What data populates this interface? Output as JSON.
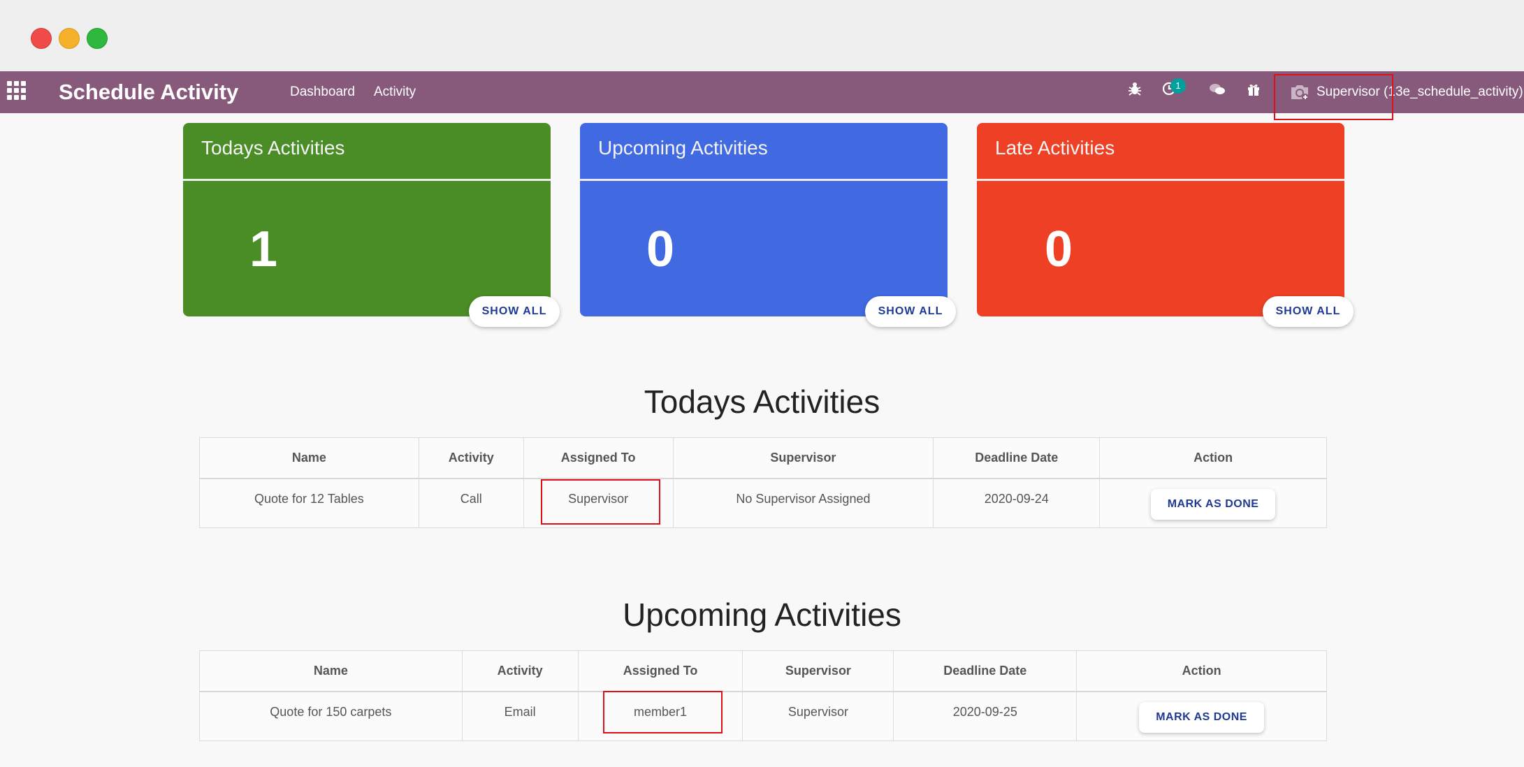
{
  "navbar": {
    "brand": "Schedule Activity",
    "menu": [
      "Dashboard",
      "Activity"
    ],
    "activity_badge": "1",
    "user": "Supervisor (13e_schedule_activity)",
    "colors": {
      "bar": "#875a7b"
    }
  },
  "cards": [
    {
      "title": "Todays Activities",
      "count": "1",
      "button": "SHOW ALL",
      "color": "#4a8d26"
    },
    {
      "title": "Upcoming Activities",
      "count": "0",
      "button": "SHOW ALL",
      "color": "#4169e1"
    },
    {
      "title": "Late Activities",
      "count": "0",
      "button": "SHOW ALL",
      "color": "#ee4024"
    }
  ],
  "today": {
    "title": "Todays Activities",
    "headers": [
      "Name",
      "Activity",
      "Assigned To",
      "Supervisor",
      "Deadline Date",
      "Action"
    ],
    "rows": [
      {
        "name": "Quote for 12 Tables",
        "activity": "Call",
        "assigned_to": "Supervisor",
        "supervisor": "No Supervisor Assigned",
        "deadline": "2020-09-24",
        "action": "MARK AS DONE"
      }
    ]
  },
  "upcoming": {
    "title": "Upcoming Activities",
    "headers": [
      "Name",
      "Activity",
      "Assigned To",
      "Supervisor",
      "Deadline Date",
      "Action"
    ],
    "rows": [
      {
        "name": "Quote for 150 carpets",
        "activity": "Email",
        "assigned_to": "member1",
        "supervisor": "Supervisor",
        "deadline": "2020-09-25",
        "action": "MARK AS DONE"
      }
    ]
  }
}
